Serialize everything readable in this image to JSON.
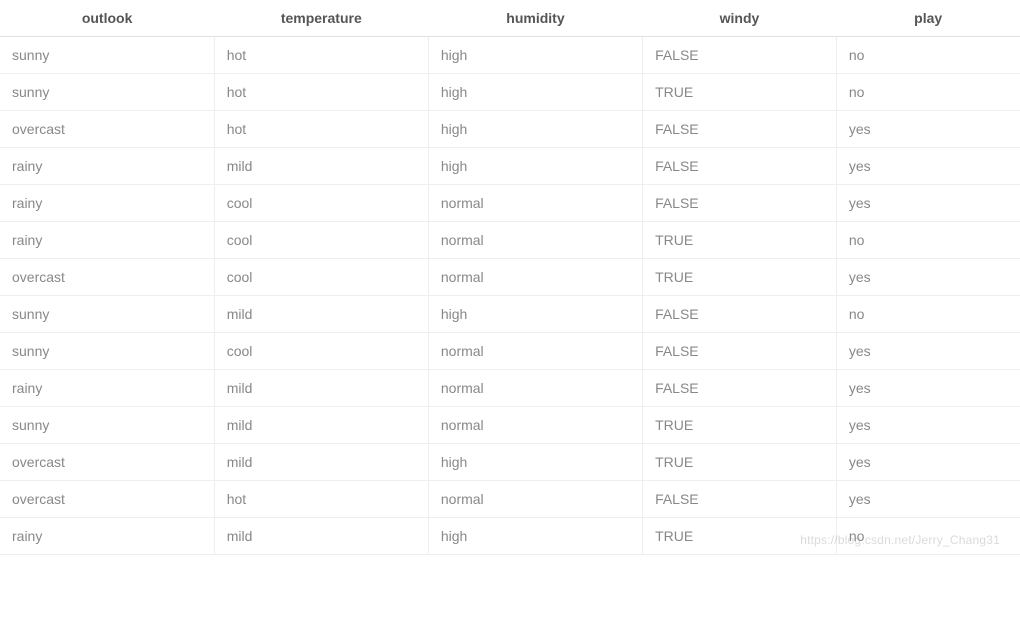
{
  "chart_data": {
    "type": "table",
    "columns": [
      "outlook",
      "temperature",
      "humidity",
      "windy",
      "play"
    ],
    "rows": [
      [
        "sunny",
        "hot",
        "high",
        "FALSE",
        "no"
      ],
      [
        "sunny",
        "hot",
        "high",
        "TRUE",
        "no"
      ],
      [
        "overcast",
        "hot",
        "high",
        "FALSE",
        "yes"
      ],
      [
        "rainy",
        "mild",
        "high",
        "FALSE",
        "yes"
      ],
      [
        "rainy",
        "cool",
        "normal",
        "FALSE",
        "yes"
      ],
      [
        "rainy",
        "cool",
        "normal",
        "TRUE",
        "no"
      ],
      [
        "overcast",
        "cool",
        "normal",
        "TRUE",
        "yes"
      ],
      [
        "sunny",
        "mild",
        "high",
        "FALSE",
        "no"
      ],
      [
        "sunny",
        "cool",
        "normal",
        "FALSE",
        "yes"
      ],
      [
        "rainy",
        "mild",
        "normal",
        "FALSE",
        "yes"
      ],
      [
        "sunny",
        "mild",
        "normal",
        "TRUE",
        "yes"
      ],
      [
        "overcast",
        "mild",
        "high",
        "TRUE",
        "yes"
      ],
      [
        "overcast",
        "hot",
        "normal",
        "FALSE",
        "yes"
      ],
      [
        "rainy",
        "mild",
        "high",
        "TRUE",
        "no"
      ]
    ]
  },
  "watermark": "https://blog.csdn.net/Jerry_Chang31"
}
